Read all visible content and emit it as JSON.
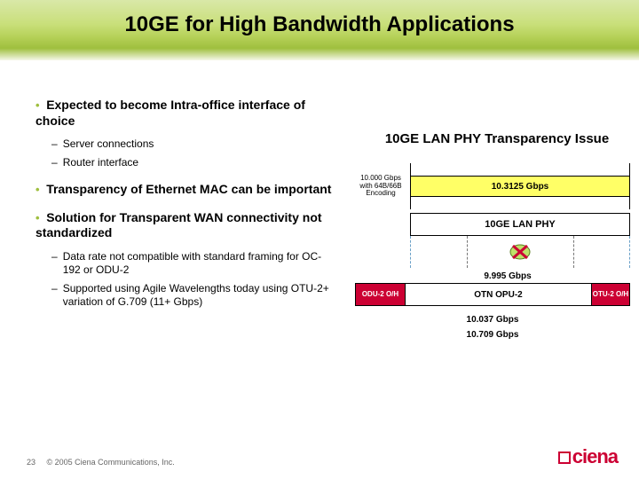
{
  "title": "10GE for High Bandwidth Applications",
  "bullets": {
    "b1": "Expected to become Intra-office interface of choice",
    "b1a": "Server connections",
    "b1b": "Router interface",
    "b2": "Transparency of Ethernet MAC can be important",
    "b3": "Solution for Transparent WAN connectivity not standardized",
    "b3a": "Data rate not compatible with standard framing for OC-192 or ODU-2",
    "b3b": "Supported using Agile Wavelengths today using OTU-2+ variation of G.709 (11+ Gbps)"
  },
  "diagram": {
    "heading": "10GE LAN PHY Transparency Issue",
    "encoding_label_l1": "10.000 Gbps",
    "encoding_label_l2": "with 64B/66B",
    "encoding_label_l3": "Encoding",
    "rate_top": "10.3125 Gbps",
    "lan_phy": "10GE LAN PHY",
    "rate_opu_payload": "9.995 Gbps",
    "odu_oh": "ODU-2 O/H",
    "opu2": "OTN OPU-2",
    "otu_oh": "OTU-2 O/H",
    "rate_odu": "10.037 Gbps",
    "rate_otu": "10.709 Gbps"
  },
  "footer": {
    "page": "23",
    "copyright": "© 2005 Ciena Communications, Inc."
  },
  "logo_text": "ciena"
}
